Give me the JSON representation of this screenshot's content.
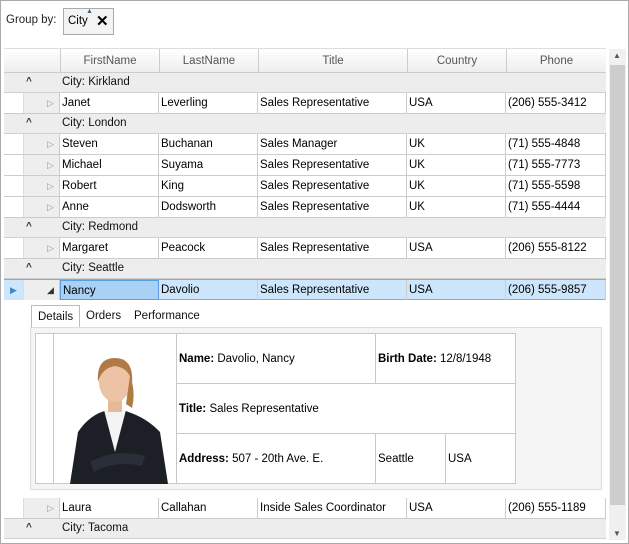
{
  "group_panel": {
    "label": "Group by:",
    "chip": "City"
  },
  "columns": [
    "FirstName",
    "LastName",
    "Title",
    "Country",
    "Phone"
  ],
  "groups": [
    {
      "label": "City: Kirkland",
      "rows": [
        [
          "Janet",
          "Leverling",
          "Sales Representative",
          "USA",
          "(206) 555-3412"
        ]
      ]
    },
    {
      "label": "City: London",
      "rows": [
        [
          "Steven",
          "Buchanan",
          "Sales Manager",
          "UK",
          "(71) 555-4848"
        ],
        [
          "Michael",
          "Suyama",
          "Sales Representative",
          "UK",
          "(71) 555-7773"
        ],
        [
          "Robert",
          "King",
          "Sales Representative",
          "UK",
          "(71) 555-5598"
        ],
        [
          "Anne",
          "Dodsworth",
          "Sales Representative",
          "UK",
          "(71) 555-4444"
        ]
      ]
    },
    {
      "label": "City: Redmond",
      "rows": [
        [
          "Margaret",
          "Peacock",
          "Sales Representative",
          "USA",
          "(206) 555-8122"
        ]
      ]
    },
    {
      "label": "City: Seattle",
      "rows": [
        [
          "Nancy",
          "Davolio",
          "Sales Representative",
          "USA",
          "(206) 555-9857"
        ],
        [
          "Laura",
          "Callahan",
          "Inside Sales Coordinator",
          "USA",
          "(206) 555-1189"
        ]
      ]
    },
    {
      "label": "City: Tacoma",
      "rows": []
    }
  ],
  "details": {
    "tabs": [
      "Details",
      "Orders",
      "Performance"
    ],
    "name_label": "Name:",
    "name": "Davolio, Nancy",
    "birth_label": "Birth Date:",
    "birth": "12/8/1948",
    "title_label": "Title:",
    "title": "Sales Representative",
    "address_label": "Address:",
    "address": "507 - 20th Ave. E.",
    "city": "Seattle",
    "country": "USA"
  }
}
